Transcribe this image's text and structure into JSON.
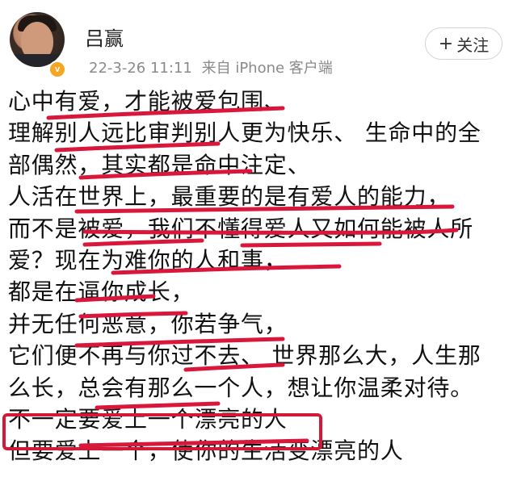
{
  "header": {
    "username": "吕赢",
    "date": "22-3-26 11:11",
    "source": "来自 iPhone 客户端",
    "follow_label": "关注",
    "follow_icon": "plus-icon",
    "vip_badge": "v"
  },
  "post": {
    "lines": [
      "心中有爱，才能被爱包围、",
      "理解别人远比审判别人更为快乐、 生命中的全",
      "部偶然，其实都是命中注定、",
      "人活在世界上，最重要的是有爱人的能力，",
      "而不是被爱，我们不懂得爱人又如何能被人所",
      "爱？现在为难你的人和事，",
      "都是在逼你成长，",
      "并无任何恶意，你若争气，",
      "它们便不再与你过不去、 世界那么大，人生那",
      "么长，总会有那么一个人，想让你温柔对待。",
      "不一定要爱上一个漂亮的人",
      "但要爱上一个，使你的生活变漂亮的人"
    ]
  },
  "annotations": {
    "underline_color": "#d8173a",
    "box_color": "#d21a38"
  }
}
